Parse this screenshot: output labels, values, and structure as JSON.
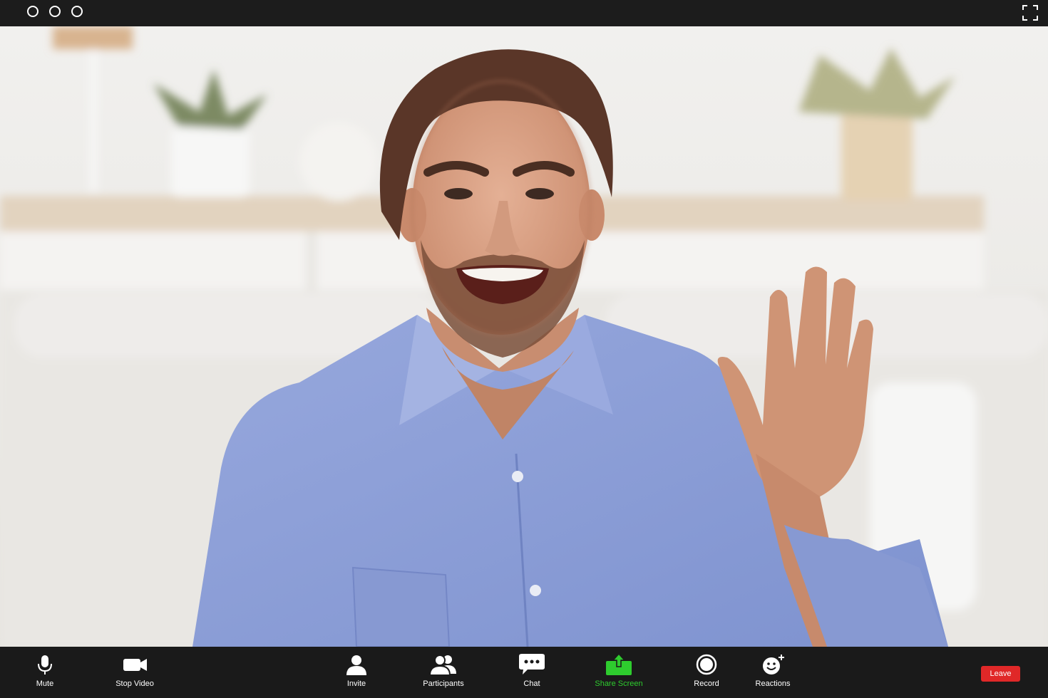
{
  "window": {
    "controls": [
      "window-control",
      "window-control",
      "window-control"
    ]
  },
  "toolbar": {
    "items": [
      {
        "label": "Mute",
        "icon": "microphone-icon"
      },
      {
        "label": "Stop Video",
        "icon": "video-camera-icon"
      },
      {
        "label": "Invite",
        "icon": "person-icon"
      },
      {
        "label": "Participants",
        "icon": "participants-icon"
      },
      {
        "label": "Chat",
        "icon": "chat-bubble-icon"
      },
      {
        "label": "Share Screen",
        "icon": "share-screen-icon"
      },
      {
        "label": "Record",
        "icon": "record-icon"
      },
      {
        "label": "Reactions",
        "icon": "smiley-plus-icon"
      }
    ],
    "leave_label": "Leave"
  },
  "colors": {
    "topbar": "#1c1c1c",
    "toolbar": "#1a1a1a",
    "share_accent": "#2ecc2e",
    "leave": "#e02828",
    "shirt": "#8d9fd6"
  }
}
